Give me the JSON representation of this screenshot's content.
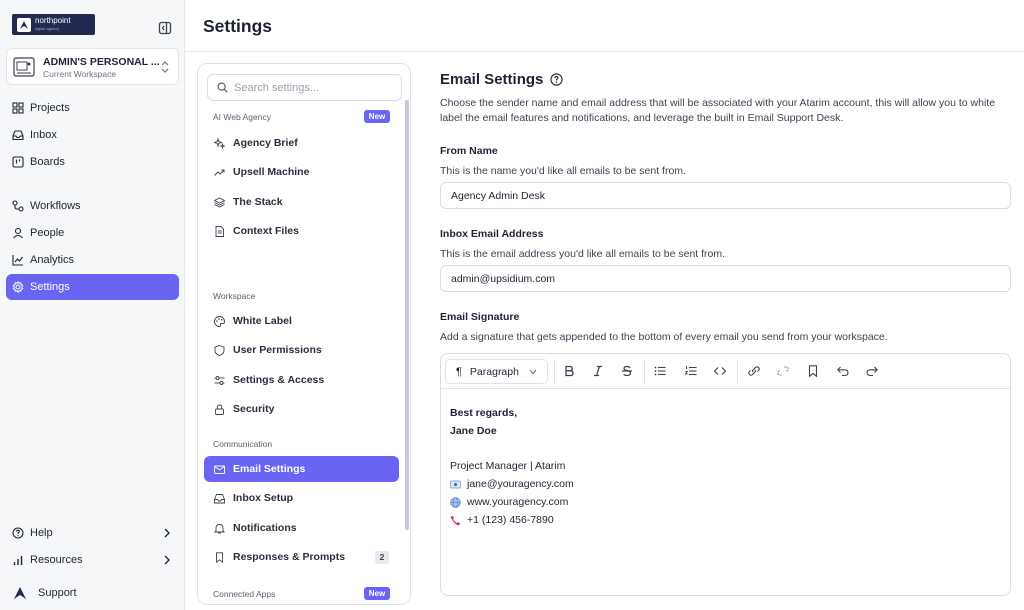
{
  "brand": {
    "name": "northpoint",
    "tagline": "digital agency"
  },
  "workspace": {
    "name": "ADMIN'S PERSONAL ...",
    "subtitle": "Current Workspace"
  },
  "nav": {
    "projects": "Projects",
    "inbox": "Inbox",
    "boards": "Boards",
    "workflows": "Workflows",
    "people": "People",
    "analytics": "Analytics",
    "settings": "Settings",
    "help": "Help",
    "resources": "Resources",
    "support": "Support"
  },
  "header": {
    "title": "Settings"
  },
  "settings_menu": {
    "search_placeholder": "Search settings...",
    "groups": {
      "ai": {
        "label": "AI Web Agency",
        "badge": "New"
      },
      "workspace": {
        "label": "Workspace"
      },
      "communication": {
        "label": "Communication"
      },
      "connected": {
        "label": "Connected Apps",
        "badge": "New"
      }
    },
    "items": {
      "agency_brief": "Agency Brief",
      "upsell_machine": "Upsell Machine",
      "the_stack": "The Stack",
      "context_files": "Context Files",
      "white_label": "White Label",
      "user_permissions": "User Permissions",
      "settings_access": "Settings & Access",
      "security": "Security",
      "email_settings": "Email Settings",
      "inbox_setup": "Inbox Setup",
      "notifications": "Notifications",
      "responses_prompts": "Responses & Prompts",
      "responses_prompts_count": "2"
    }
  },
  "email_settings": {
    "title": "Email Settings",
    "description": "Choose the sender name and email address that will be associated with your Atarim account, this will allow you to white label the email features and notifications, and leverage the built in Email Support Desk.",
    "from_name": {
      "label": "From Name",
      "help": "This is the name you'd like all emails to be sent from.",
      "value": "Agency Admin Desk"
    },
    "inbox_email": {
      "label": "Inbox Email Address",
      "help": "This is the email address you'd like all emails to be sent from.",
      "value": "admin@upsidium.com"
    },
    "signature": {
      "label": "Email Signature",
      "help": "Add a signature that gets appended to the bottom of every email you send from your workspace.",
      "paragraph_select": "Paragraph",
      "lines": {
        "closing": "Best regards,",
        "name": "Jane Doe",
        "role": "Project Manager | Atarim",
        "email": "jane@youragency.com",
        "website": "www.youragency.com",
        "phone": "+1 (123) 456-7890"
      }
    }
  },
  "colors": {
    "accent": "#6b63f2",
    "brand_bg": "#232a52"
  }
}
